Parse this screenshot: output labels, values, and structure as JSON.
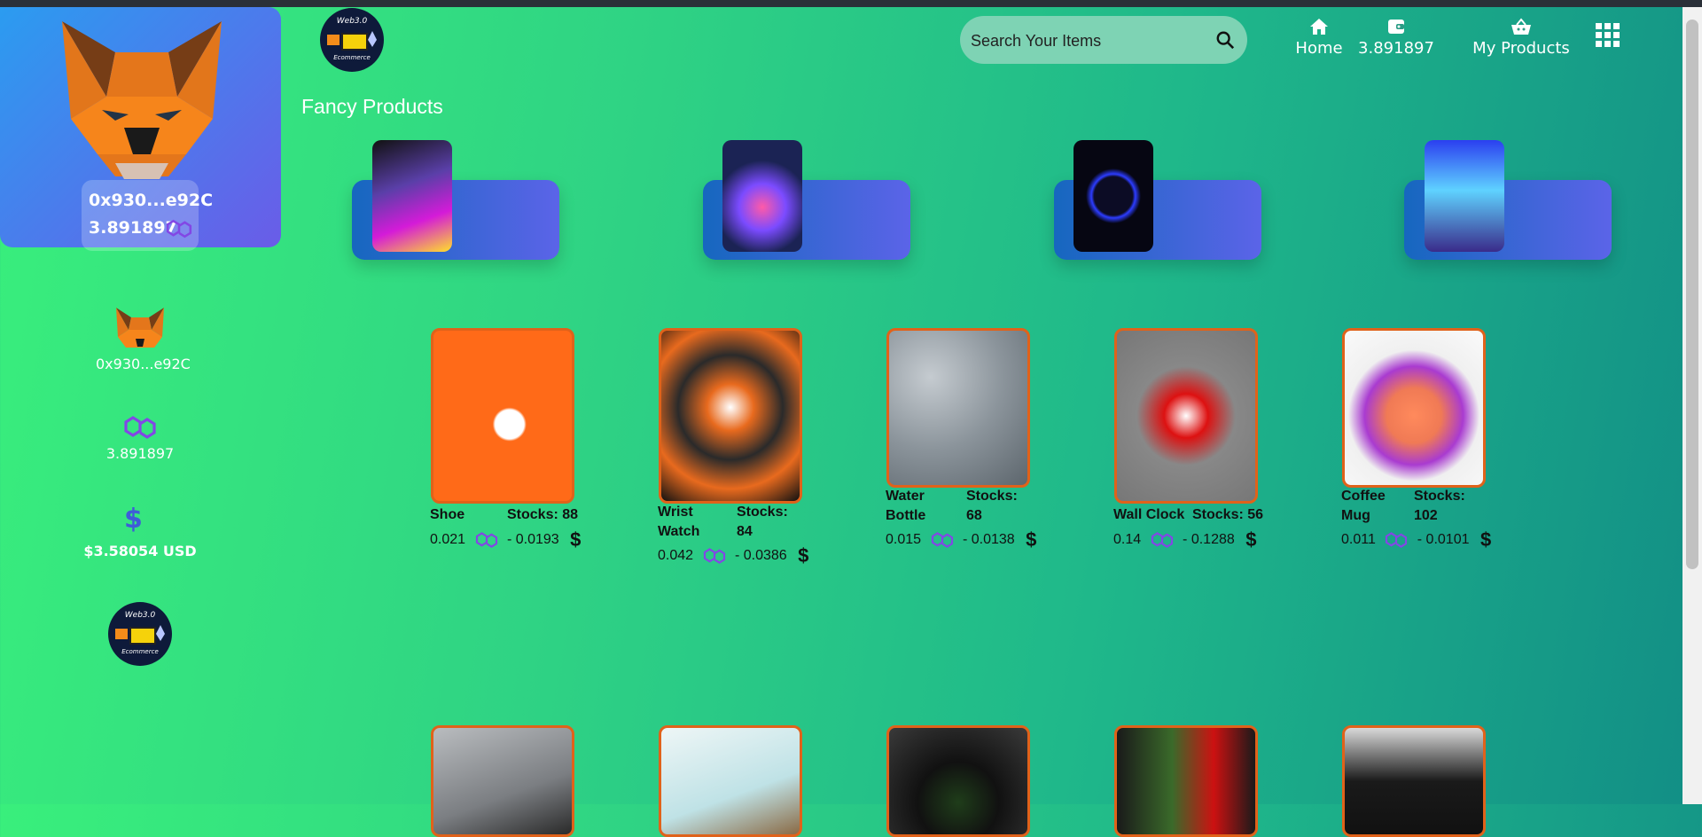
{
  "wallet": {
    "address": "0x930...e92C",
    "balance": "3.891897",
    "usd": "$3.58054 USD"
  },
  "header": {
    "search_placeholder": "Search Your Items",
    "nav": [
      {
        "label": "Home",
        "icon": "home-icon"
      },
      {
        "label": "3.891897",
        "icon": "wallet-icon"
      },
      {
        "label": "My Products",
        "icon": "basket-icon"
      }
    ]
  },
  "logo": {
    "title": "Web3.0",
    "subtitle": "Ecommerce"
  },
  "fancy": {
    "title": "Fancy Products"
  },
  "products": [
    {
      "name": "Shoe",
      "stocks": "Stocks: 88",
      "pol": "0.021",
      "usd": "0.0193"
    },
    {
      "name": "Wrist Watch",
      "stocks": "Stocks: 84",
      "pol": "0.042",
      "usd": "0.0386"
    },
    {
      "name": "Water Bottle",
      "stocks": "Stocks: 68",
      "pol": "0.015",
      "usd": "0.0138"
    },
    {
      "name": "Wall Clock",
      "stocks": "Stocks: 56",
      "pol": "0.14",
      "usd": "0.1288"
    },
    {
      "name": "Coffee Mug",
      "stocks": "Stocks: 102",
      "pol": "0.011",
      "usd": "0.0101"
    }
  ],
  "colors": {
    "accent": "#e0621a",
    "card": "#5b64e8",
    "polygon": "#8247e5"
  }
}
